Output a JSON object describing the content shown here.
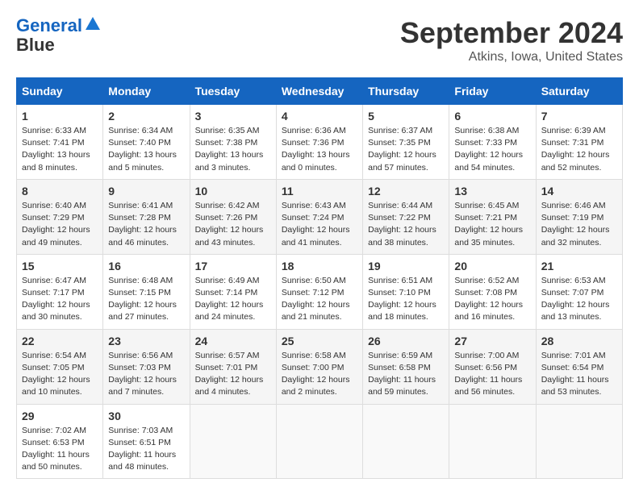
{
  "logo": {
    "line1": "General",
    "line2": "Blue"
  },
  "title": "September 2024",
  "location": "Atkins, Iowa, United States",
  "headers": [
    "Sunday",
    "Monday",
    "Tuesday",
    "Wednesday",
    "Thursday",
    "Friday",
    "Saturday"
  ],
  "weeks": [
    [
      {
        "day": "1",
        "info": "Sunrise: 6:33 AM\nSunset: 7:41 PM\nDaylight: 13 hours\nand 8 minutes."
      },
      {
        "day": "2",
        "info": "Sunrise: 6:34 AM\nSunset: 7:40 PM\nDaylight: 13 hours\nand 5 minutes."
      },
      {
        "day": "3",
        "info": "Sunrise: 6:35 AM\nSunset: 7:38 PM\nDaylight: 13 hours\nand 3 minutes."
      },
      {
        "day": "4",
        "info": "Sunrise: 6:36 AM\nSunset: 7:36 PM\nDaylight: 13 hours\nand 0 minutes."
      },
      {
        "day": "5",
        "info": "Sunrise: 6:37 AM\nSunset: 7:35 PM\nDaylight: 12 hours\nand 57 minutes."
      },
      {
        "day": "6",
        "info": "Sunrise: 6:38 AM\nSunset: 7:33 PM\nDaylight: 12 hours\nand 54 minutes."
      },
      {
        "day": "7",
        "info": "Sunrise: 6:39 AM\nSunset: 7:31 PM\nDaylight: 12 hours\nand 52 minutes."
      }
    ],
    [
      {
        "day": "8",
        "info": "Sunrise: 6:40 AM\nSunset: 7:29 PM\nDaylight: 12 hours\nand 49 minutes."
      },
      {
        "day": "9",
        "info": "Sunrise: 6:41 AM\nSunset: 7:28 PM\nDaylight: 12 hours\nand 46 minutes."
      },
      {
        "day": "10",
        "info": "Sunrise: 6:42 AM\nSunset: 7:26 PM\nDaylight: 12 hours\nand 43 minutes."
      },
      {
        "day": "11",
        "info": "Sunrise: 6:43 AM\nSunset: 7:24 PM\nDaylight: 12 hours\nand 41 minutes."
      },
      {
        "day": "12",
        "info": "Sunrise: 6:44 AM\nSunset: 7:22 PM\nDaylight: 12 hours\nand 38 minutes."
      },
      {
        "day": "13",
        "info": "Sunrise: 6:45 AM\nSunset: 7:21 PM\nDaylight: 12 hours\nand 35 minutes."
      },
      {
        "day": "14",
        "info": "Sunrise: 6:46 AM\nSunset: 7:19 PM\nDaylight: 12 hours\nand 32 minutes."
      }
    ],
    [
      {
        "day": "15",
        "info": "Sunrise: 6:47 AM\nSunset: 7:17 PM\nDaylight: 12 hours\nand 30 minutes."
      },
      {
        "day": "16",
        "info": "Sunrise: 6:48 AM\nSunset: 7:15 PM\nDaylight: 12 hours\nand 27 minutes."
      },
      {
        "day": "17",
        "info": "Sunrise: 6:49 AM\nSunset: 7:14 PM\nDaylight: 12 hours\nand 24 minutes."
      },
      {
        "day": "18",
        "info": "Sunrise: 6:50 AM\nSunset: 7:12 PM\nDaylight: 12 hours\nand 21 minutes."
      },
      {
        "day": "19",
        "info": "Sunrise: 6:51 AM\nSunset: 7:10 PM\nDaylight: 12 hours\nand 18 minutes."
      },
      {
        "day": "20",
        "info": "Sunrise: 6:52 AM\nSunset: 7:08 PM\nDaylight: 12 hours\nand 16 minutes."
      },
      {
        "day": "21",
        "info": "Sunrise: 6:53 AM\nSunset: 7:07 PM\nDaylight: 12 hours\nand 13 minutes."
      }
    ],
    [
      {
        "day": "22",
        "info": "Sunrise: 6:54 AM\nSunset: 7:05 PM\nDaylight: 12 hours\nand 10 minutes."
      },
      {
        "day": "23",
        "info": "Sunrise: 6:56 AM\nSunset: 7:03 PM\nDaylight: 12 hours\nand 7 minutes."
      },
      {
        "day": "24",
        "info": "Sunrise: 6:57 AM\nSunset: 7:01 PM\nDaylight: 12 hours\nand 4 minutes."
      },
      {
        "day": "25",
        "info": "Sunrise: 6:58 AM\nSunset: 7:00 PM\nDaylight: 12 hours\nand 2 minutes."
      },
      {
        "day": "26",
        "info": "Sunrise: 6:59 AM\nSunset: 6:58 PM\nDaylight: 11 hours\nand 59 minutes."
      },
      {
        "day": "27",
        "info": "Sunrise: 7:00 AM\nSunset: 6:56 PM\nDaylight: 11 hours\nand 56 minutes."
      },
      {
        "day": "28",
        "info": "Sunrise: 7:01 AM\nSunset: 6:54 PM\nDaylight: 11 hours\nand 53 minutes."
      }
    ],
    [
      {
        "day": "29",
        "info": "Sunrise: 7:02 AM\nSunset: 6:53 PM\nDaylight: 11 hours\nand 50 minutes."
      },
      {
        "day": "30",
        "info": "Sunrise: 7:03 AM\nSunset: 6:51 PM\nDaylight: 11 hours\nand 48 minutes."
      },
      null,
      null,
      null,
      null,
      null
    ]
  ]
}
